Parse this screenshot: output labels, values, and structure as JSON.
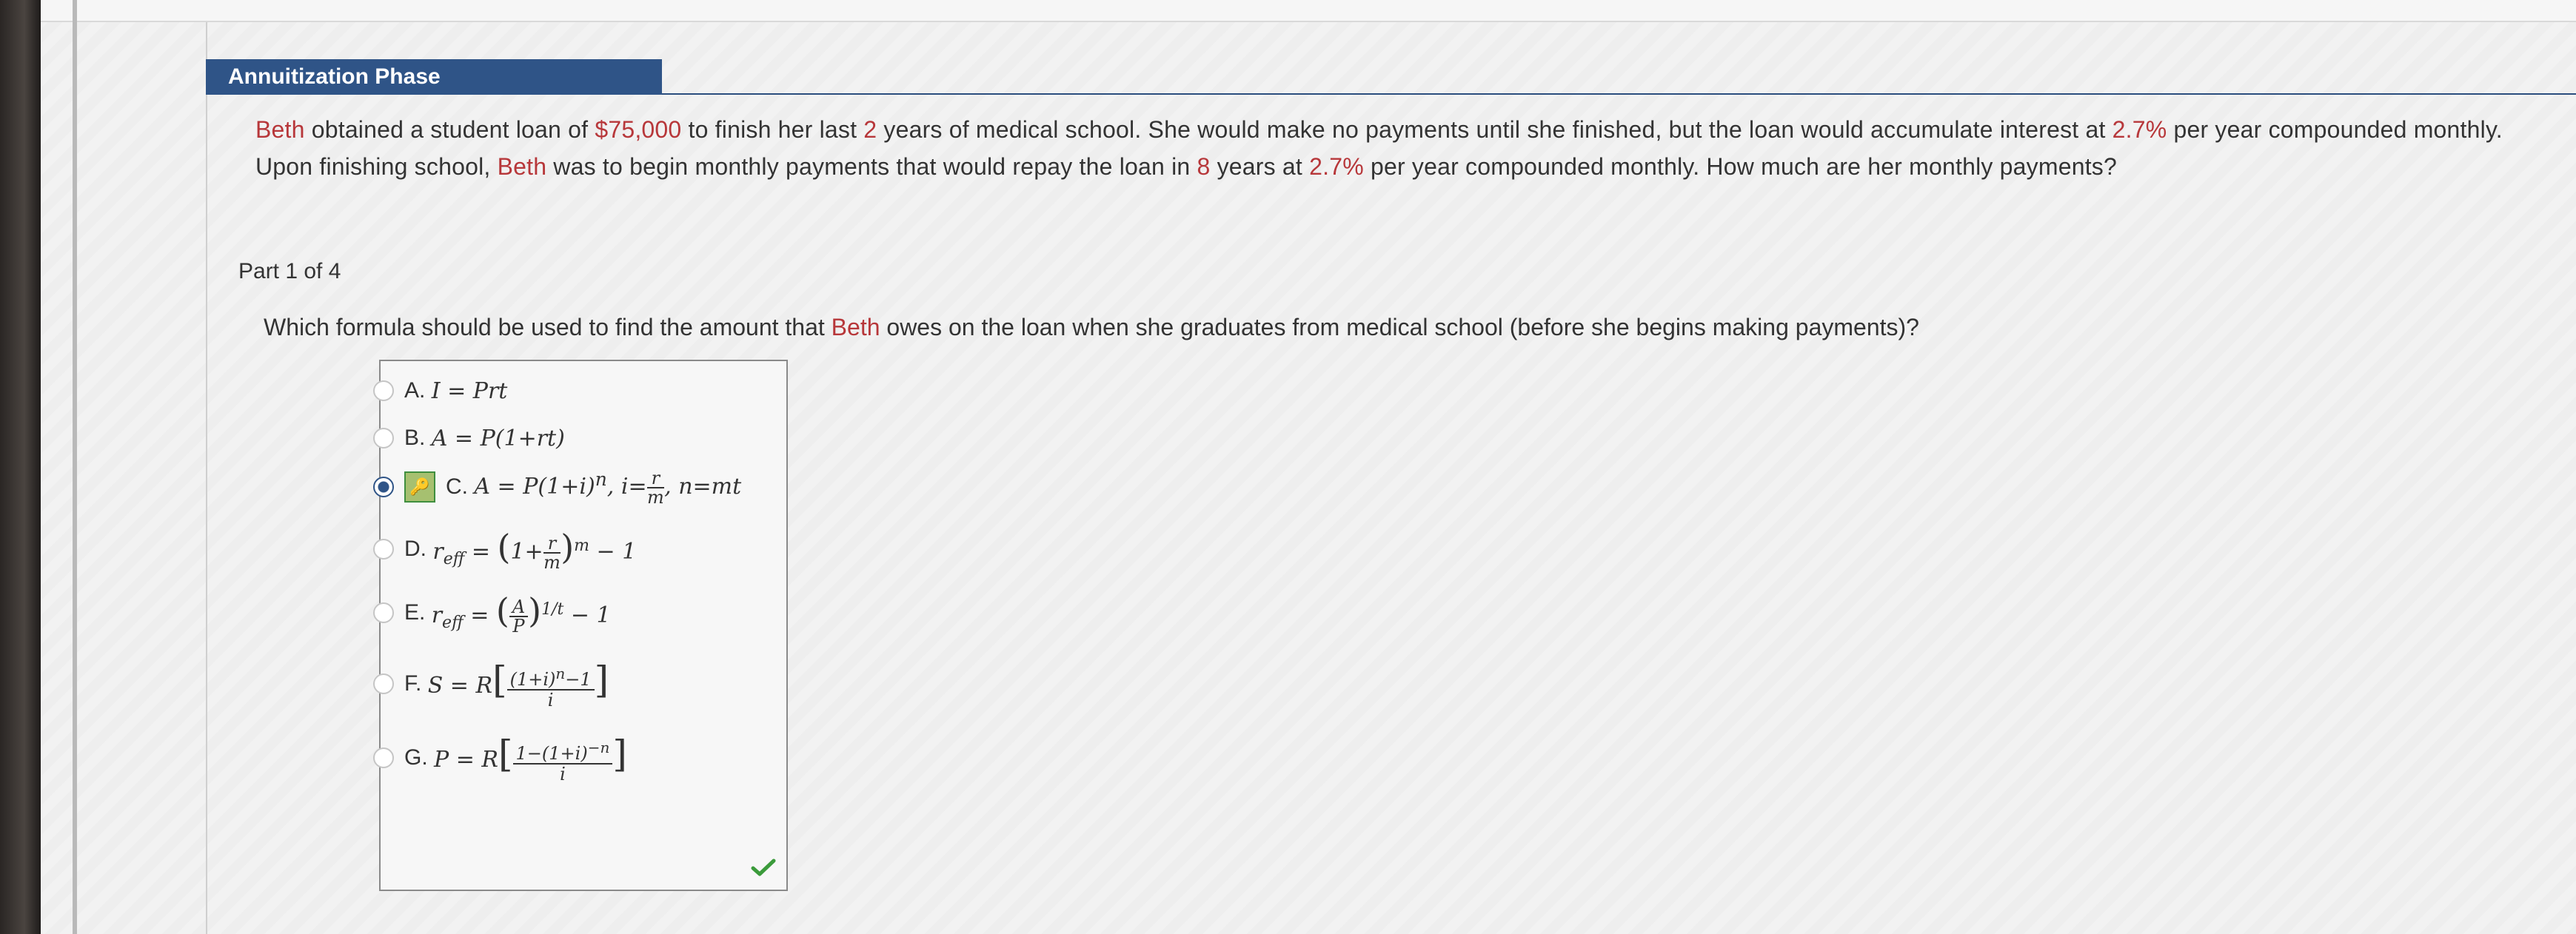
{
  "phase": {
    "title": "Annuitization Phase"
  },
  "problem": {
    "p1": "Beth",
    "p2": " obtained a student loan of ",
    "p3": "$75,000",
    "p4": " to finish her last ",
    "p5": "2",
    "p6": " years of medical school. She would make no payments until she finished, but the loan would accumulate interest at ",
    "p7": "2.7%",
    "p8": " per year compounded monthly. Upon finishing school, ",
    "p9": "Beth",
    "p10": " was to begin monthly payments that would repay the loan in ",
    "p11": "8",
    "p12": " years at ",
    "p13": "2.7%",
    "p14": " per year compounded monthly. How much are her monthly payments?"
  },
  "part": {
    "label": "Part 1 of 4"
  },
  "question": {
    "q1": "Which formula should be used to find the amount that ",
    "q2": "Beth",
    "q3": " owes on the loan when she graduates from medical school (before she begins making payments)?"
  },
  "choices": [
    {
      "letter": "A.",
      "formula": "I = Prt",
      "selected": false
    },
    {
      "letter": "B.",
      "formula": "A = P(1+rt)",
      "selected": false
    },
    {
      "letter": "C.",
      "formula": "A = P(1+i)ⁿ, i = r/m, n=mt",
      "selected": true
    },
    {
      "letter": "D.",
      "formula": "r_eff = (1 + r/m)^m − 1",
      "selected": false
    },
    {
      "letter": "E.",
      "formula": "r_eff = (A/P)^(1/t) − 1",
      "selected": false
    },
    {
      "letter": "F.",
      "formula": "S = R[((1+i)ⁿ − 1)/i]",
      "selected": false
    },
    {
      "letter": "G.",
      "formula": "P = R[(1 − (1+i)⁻ⁿ)/i]",
      "selected": false
    }
  ],
  "colors": {
    "accent": "#2f5487",
    "highlight": "#b7373a",
    "correct": "#3b9b3b"
  },
  "icons": {
    "key": "key-icon",
    "check": "check-icon"
  }
}
